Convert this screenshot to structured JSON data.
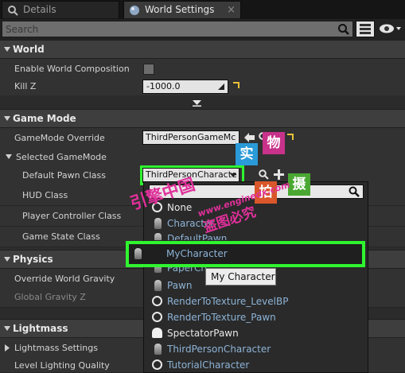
{
  "tabs": [
    {
      "label": "Details",
      "icon": "magnifier-icon"
    },
    {
      "label": "World Settings",
      "icon": "globe-icon"
    }
  ],
  "search": {
    "placeholder": "Search"
  },
  "sections": {
    "world": {
      "title": "World",
      "enable_world_composition": {
        "label": "Enable World Composition",
        "checked": false
      },
      "kill_z": {
        "label": "Kill Z",
        "value": "-1000.0"
      }
    },
    "game_mode": {
      "title": "Game Mode",
      "override": {
        "label": "GameMode Override",
        "value": "ThirdPersonGameMc"
      },
      "selected_label": "Selected GameMode",
      "default_pawn": {
        "label": "Default Pawn Class",
        "value": "ThirdPersonCharacte"
      },
      "hud_label": "HUD Class",
      "player_controller_label": "Player Controller Class",
      "game_state_label": "Game State Class"
    },
    "physics": {
      "title": "Physics",
      "override_gravity": {
        "label": "Override World Gravity"
      },
      "global_gravity": {
        "label": "Global Gravity Z"
      }
    },
    "lightmass": {
      "title": "Lightmass",
      "settings_label": "Lightmass Settings",
      "quality_label": "Level Lighting Quality"
    }
  },
  "dropdown": {
    "items": [
      {
        "label": "None",
        "icon": "circle-icon"
      },
      {
        "label": "Character",
        "icon": "pawn-icon"
      },
      {
        "label": "DefaultPawn",
        "icon": "pawn-icon"
      },
      {
        "label": "MyCharacter",
        "icon": "pawn-icon"
      },
      {
        "label": "PaperCh",
        "icon": "pawn-icon"
      },
      {
        "label": "Pawn",
        "icon": "pawn-icon"
      },
      {
        "label": "RenderToTexture_LevelBP",
        "icon": "circle-icon"
      },
      {
        "label": "RenderToTexture_Pawn",
        "icon": "circle-icon"
      },
      {
        "label": "SpectatorPawn",
        "icon": "ghost-icon"
      },
      {
        "label": "ThirdPersonCharacter",
        "icon": "pawn-icon"
      },
      {
        "label": "TutorialCharacter",
        "icon": "circle-icon"
      }
    ],
    "tooltip": "My Character"
  },
  "watermark": {
    "left": "引擎中国",
    "url": "www.enginedx.com",
    "right": "盗图必究",
    "boxes": [
      "实",
      "物",
      "拍",
      "摄"
    ]
  },
  "colors": {
    "highlight": "#2ff52f",
    "reset": "#e6c23a",
    "class_text": "#8db3d6"
  }
}
